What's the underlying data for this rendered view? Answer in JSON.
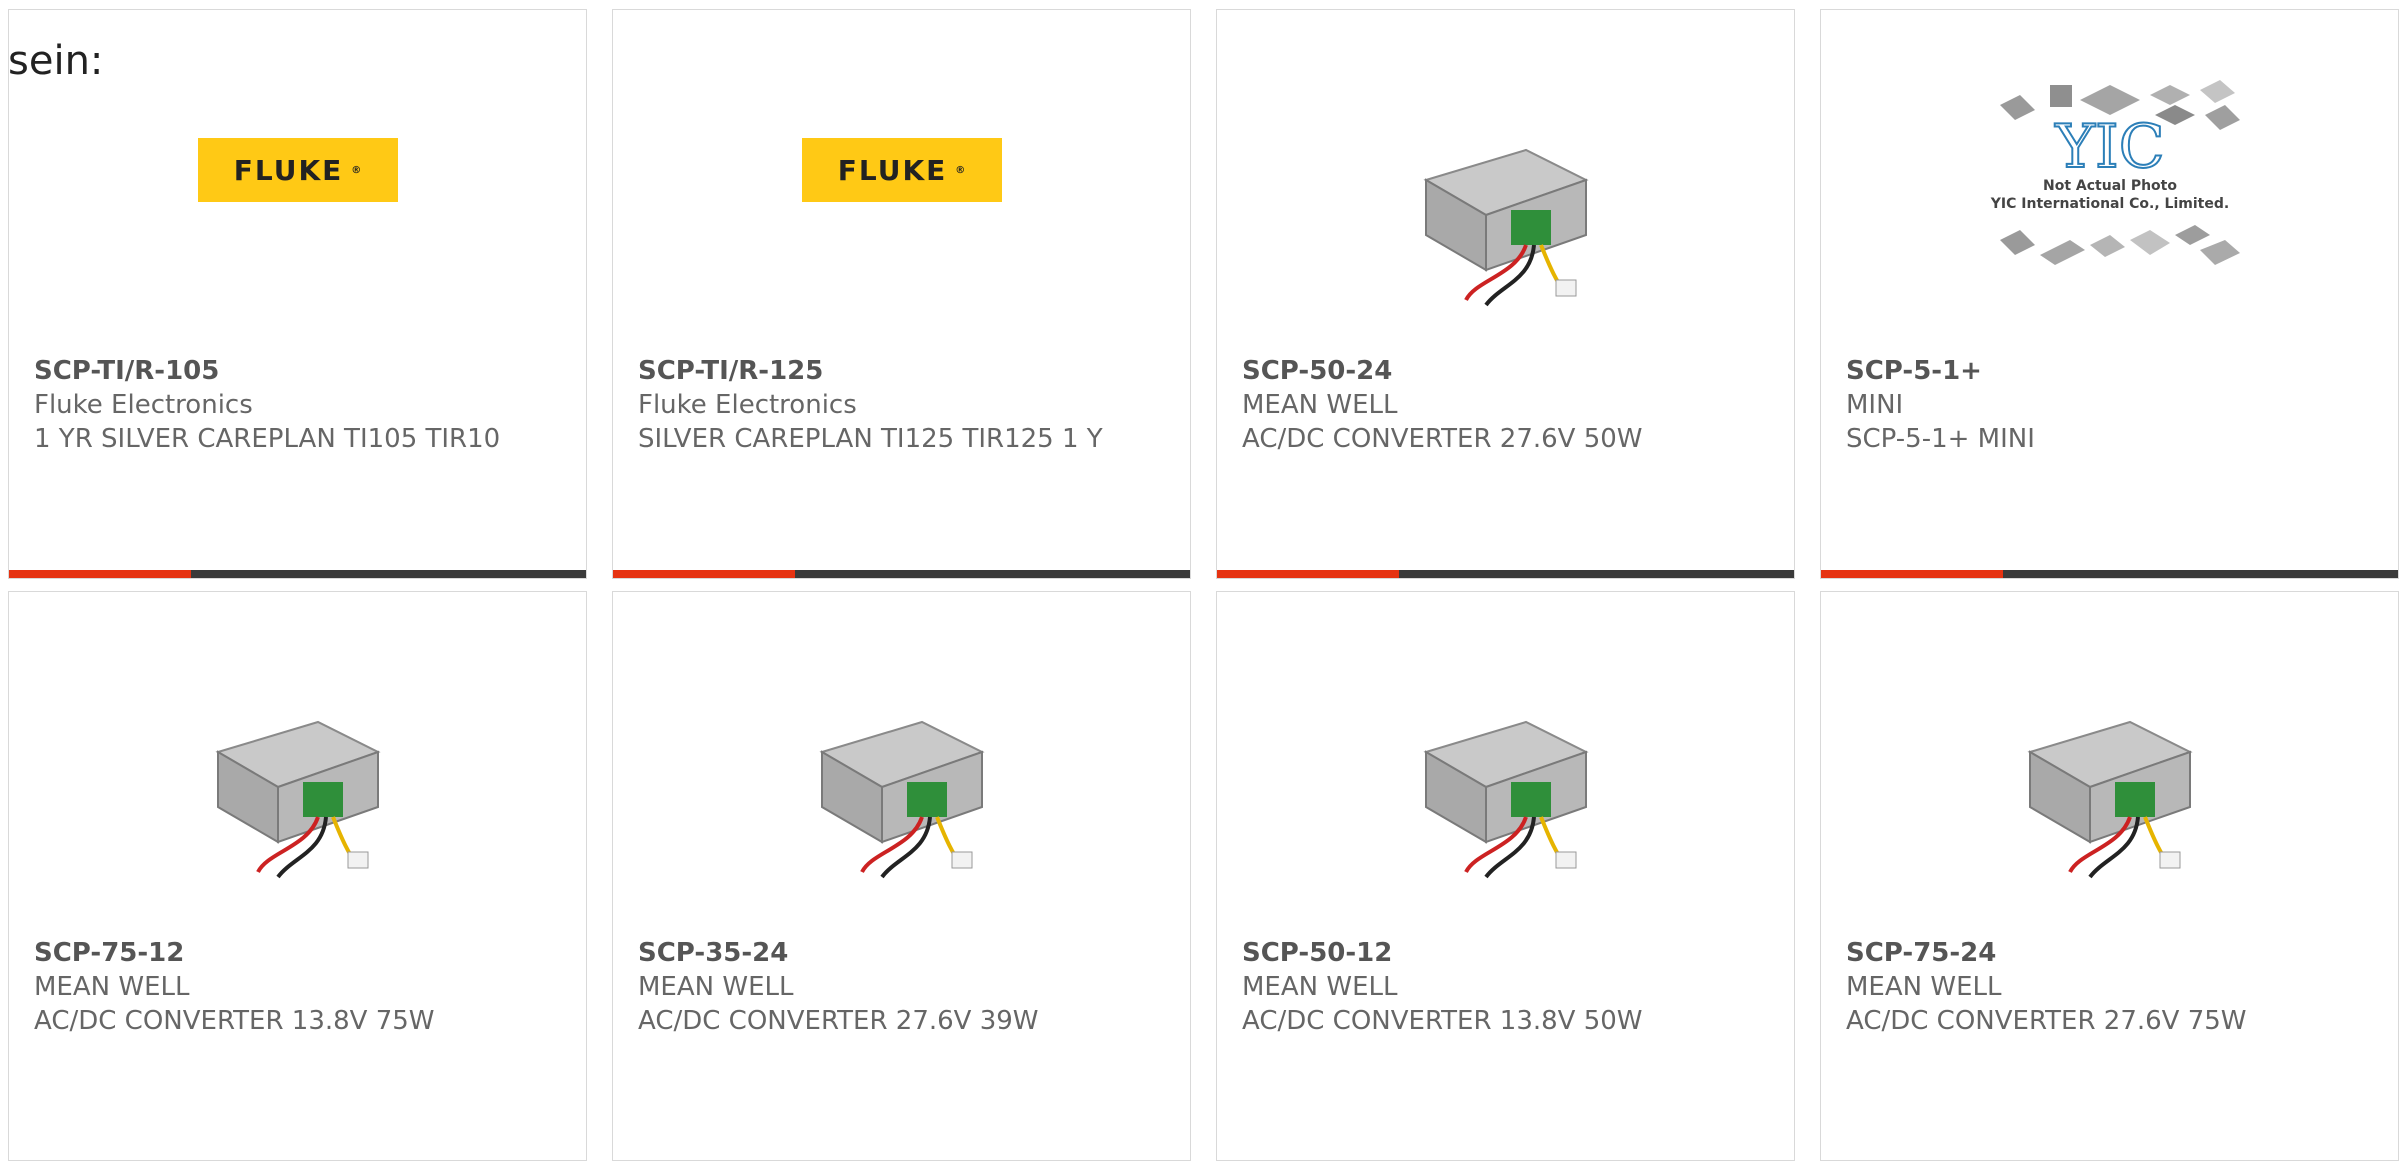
{
  "intro_text": "sein:",
  "colors": {
    "accent": "#e63312",
    "bar": "#3a3a3a",
    "fluke_yellow": "#ffc915"
  },
  "products": [
    {
      "part": "SCP-TI/R-105",
      "manufacturer": "Fluke Electronics",
      "description": "1 YR SILVER CAREPLAN TI105 TIR10",
      "image": "fluke-logo",
      "logo_text": "FLUKE"
    },
    {
      "part": "SCP-TI/R-125",
      "manufacturer": "Fluke Electronics",
      "description": "SILVER CAREPLAN TI125 TIR125 1 Y",
      "image": "fluke-logo",
      "logo_text": "FLUKE"
    },
    {
      "part": "SCP-50-24",
      "manufacturer": "MEAN WELL",
      "description": "AC/DC CONVERTER 27.6V 50W",
      "image": "power-supply"
    },
    {
      "part": "SCP-5-1+",
      "manufacturer": "MINI",
      "description": "SCP-5-1+ MINI",
      "image": "placeholder-yic",
      "placeholder_line1": "Not Actual Photo",
      "placeholder_line2": "YIC International Co., Limited."
    },
    {
      "part": "SCP-75-12",
      "manufacturer": "MEAN WELL",
      "description": "AC/DC CONVERTER 13.8V 75W",
      "image": "power-supply"
    },
    {
      "part": "SCP-35-24",
      "manufacturer": "MEAN WELL",
      "description": "AC/DC CONVERTER 27.6V 39W",
      "image": "power-supply"
    },
    {
      "part": "SCP-50-12",
      "manufacturer": "MEAN WELL",
      "description": "AC/DC CONVERTER 13.8V 50W",
      "image": "power-supply"
    },
    {
      "part": "SCP-75-24",
      "manufacturer": "MEAN WELL",
      "description": "AC/DC CONVERTER 27.6V 75W",
      "image": "power-supply"
    }
  ]
}
